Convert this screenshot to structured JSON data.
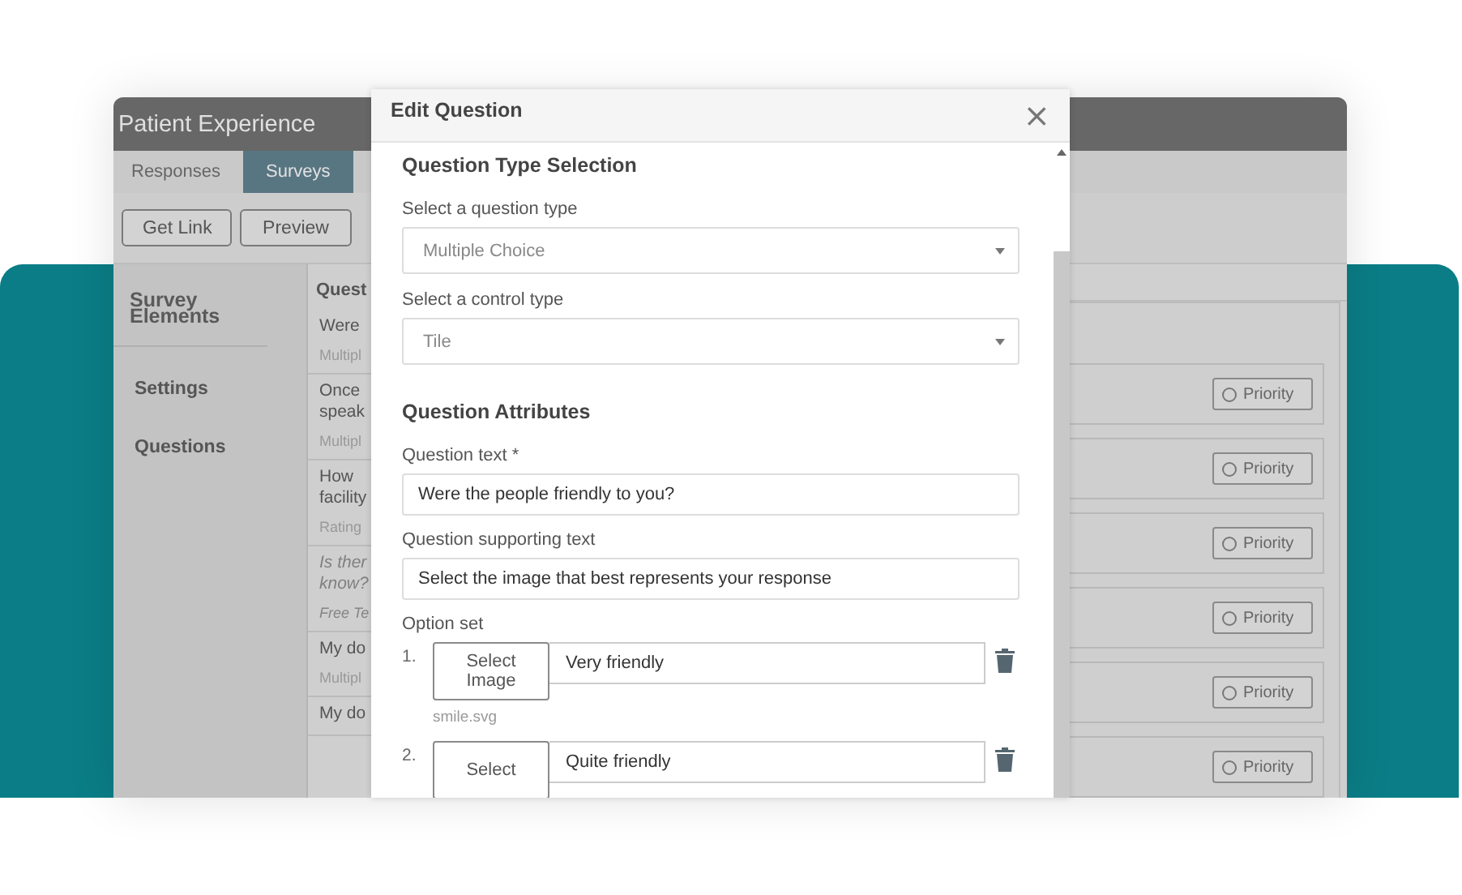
{
  "app": {
    "title": "Patient Experience",
    "tabs": [
      {
        "label": "Responses",
        "selected": false
      },
      {
        "label": "Surveys",
        "selected": true
      }
    ],
    "toolbar": [
      "Get Link",
      "Preview"
    ],
    "sidebar": {
      "title": "Survey Elements",
      "items": [
        "Settings",
        "Questions"
      ]
    },
    "question_list": {
      "title": "Quest",
      "items": [
        {
          "text": [
            "Were"
          ],
          "type": "Multipl",
          "disabled": false
        },
        {
          "text": [
            "Once",
            "speak"
          ],
          "type": "Multipl",
          "disabled": false
        },
        {
          "text": [
            "How",
            "facility"
          ],
          "type": "Rating",
          "disabled": false
        },
        {
          "text": [
            "Is ther",
            "know?"
          ],
          "type": "Free Te",
          "disabled": true
        },
        {
          "text": [
            "My do"
          ],
          "type": "Multipl",
          "disabled": false
        },
        {
          "text": [
            "My do"
          ],
          "disabled": false
        }
      ]
    },
    "priority_rows": [
      {
        "label": "Priority",
        "checked": false
      },
      {
        "label": "Priority",
        "checked": false
      },
      {
        "label": "Priority",
        "checked": false
      },
      {
        "label": "Priority",
        "checked": false
      },
      {
        "label": "Priority",
        "checked": false
      },
      {
        "label": "Priority",
        "checked": false
      }
    ]
  },
  "dialog": {
    "title": "Edit Question",
    "close": "×",
    "type_section": {
      "heading": "Question Type Selection",
      "fields": [
        {
          "label": "Select a question type",
          "value": "Multiple Choice"
        },
        {
          "label": "Select a control type",
          "value": "Tile"
        }
      ]
    },
    "attributes": {
      "heading": "Question Attributes",
      "fields": [
        {
          "label": "Question text *",
          "value": "Were the people friendly to you?"
        },
        {
          "label": "Question supporting text",
          "value": "Select the image that best represents your response"
        }
      ]
    },
    "options": {
      "label": "Option set",
      "items": [
        {
          "number": "1.",
          "button": "Select Image",
          "value": "Very friendly",
          "file": "smile.svg"
        },
        {
          "number": "2.",
          "button": "Select",
          "value": "Quite friendly"
        }
      ]
    }
  }
}
